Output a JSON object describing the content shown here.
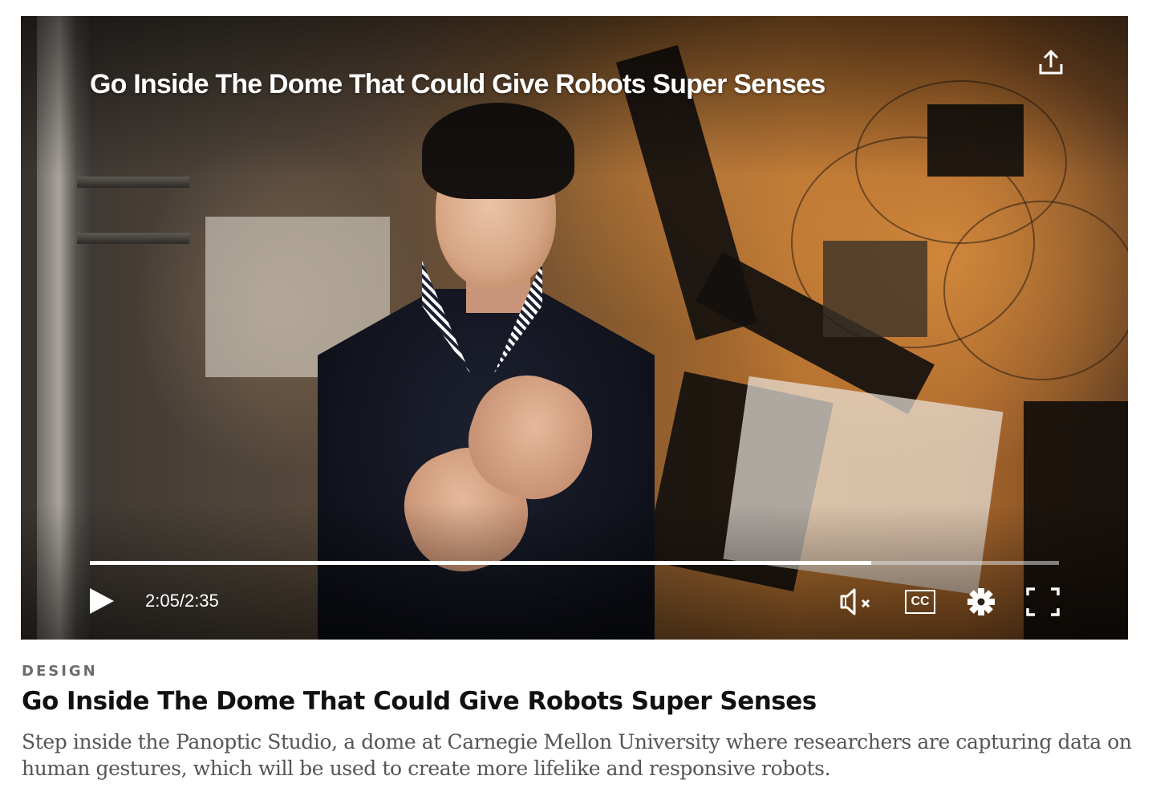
{
  "video": {
    "title": "Go Inside The Dome That Could Give Robots Super Senses",
    "current_time": "2:05",
    "separator": "/",
    "duration": "2:35",
    "progress_fraction": 0.806,
    "playing": false,
    "muted": true,
    "controls": {
      "play_icon": "play-icon",
      "mute_icon": "volume-muted-icon",
      "captions_label": "CC",
      "settings_icon": "gear-icon",
      "fullscreen_icon": "fullscreen-icon",
      "share_icon": "share-icon"
    }
  },
  "article": {
    "category": "DESIGN",
    "headline": "Go Inside The Dome That Could Give Robots Super Senses",
    "description": "Step inside the Panoptic Studio, a dome at Carnegie Mellon University where researchers are capturing data on human gestures, which will be used to create more lifelike and responsive robots."
  }
}
